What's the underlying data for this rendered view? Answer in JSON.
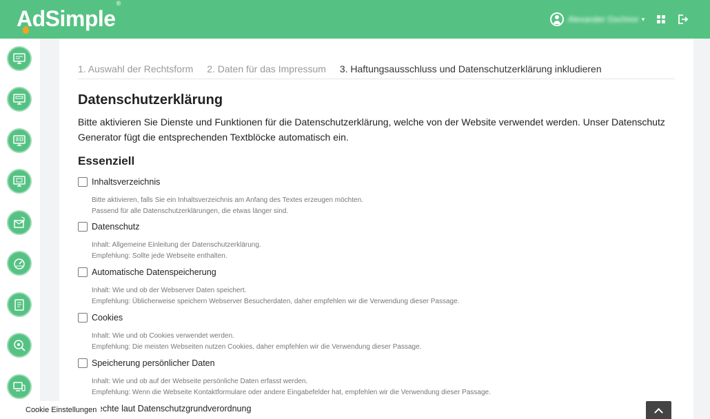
{
  "brand": {
    "name": "AdSimple",
    "trademark": "®"
  },
  "header": {
    "user_name": "Alexander Gschnor"
  },
  "steps": [
    "1. Auswahl der Rechtsform",
    "2. Daten für das Impressum",
    "3. Haftungsausschluss und Datenschutzerklärung inkludieren"
  ],
  "page": {
    "title": "Datenschutzerklärung",
    "intro": "Bitte aktivieren Sie Dienste und Funktionen für die Datenschutzerklärung, welche von der Website verwendet werden. Unser Datenschutz Generator fügt die entsprechenden Textblöcke automatisch ein.",
    "section_title": "Essenziell"
  },
  "options": [
    {
      "label": "Inhaltsverzeichnis",
      "checked": false,
      "desc1": "Bitte aktivieren, falls Sie ein Inhaltsverzeichnis am Anfang des Textes erzeugen möchten.",
      "desc2": "Passend für alle Datenschutzerklärungen, die etwas länger sind."
    },
    {
      "label": "Datenschutz",
      "checked": false,
      "desc1": "Inhalt: Allgemeine Einleitung der Datenschutzerklärung.",
      "desc2": "Empfehlung: Sollte jede Webseite enthalten."
    },
    {
      "label": "Automatische Datenspeicherung",
      "checked": false,
      "desc1": "Inhalt: Wie und ob der Webserver Daten speichert.",
      "desc2": "Empfehlung: Üblicherweise speichern Webserver Besucherdaten, daher empfehlen wir die Verwendung dieser Passage."
    },
    {
      "label": "Cookies",
      "checked": false,
      "desc1": "Inhalt: Wie und ob Cookies verwendet werden.",
      "desc2": "Empfehlung: Die meisten Webseiten nutzen Cookies, daher empfehlen wir die Verwendung dieser Passage."
    },
    {
      "label": "Speicherung persönlicher Daten",
      "checked": false,
      "desc1": "Inhalt: Wie und ob auf der Webseite persönliche Daten erfasst werden.",
      "desc2": "Empfehlung: Wenn die Webseite Kontaktformulare oder andere Eingabefelder hat, empfehlen wir die Verwendung dieser Passage."
    },
    {
      "label": "Rechte laut Datenschutzgrundverordnung",
      "checked": false
    }
  ],
  "footer": {
    "cookie_settings": "Cookie Einstellungen"
  },
  "colors": {
    "brand_green": "#55c283",
    "flame": "#f2a51c"
  },
  "sidebar_icons": [
    "monitor-icon",
    "monitor-form-icon",
    "monitor-text-icon",
    "monitor-stack-icon",
    "mail-shield-icon",
    "gauge-icon",
    "document-icon",
    "search-eye-icon",
    "devices-icon"
  ]
}
